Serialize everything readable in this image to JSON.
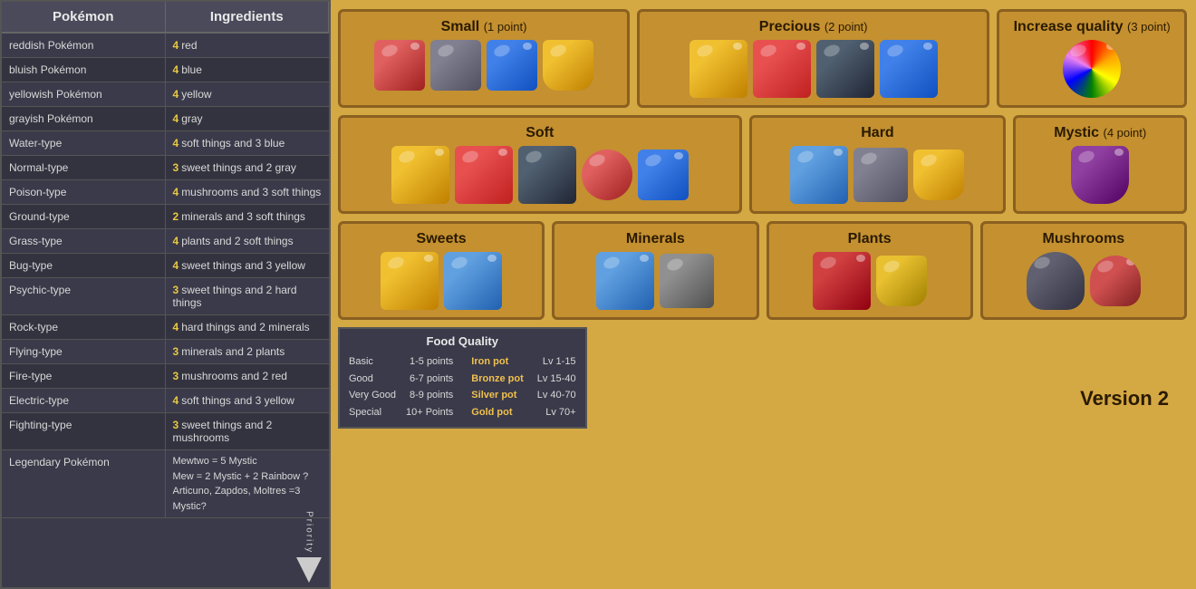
{
  "table": {
    "col1": "Pokémon",
    "col2": "Ingredients",
    "rows": [
      {
        "pokemon": "reddish Pokémon",
        "qty": "4",
        "ingredient": "red"
      },
      {
        "pokemon": "bluish Pokémon",
        "qty": "4",
        "ingredient": "blue"
      },
      {
        "pokemon": "yellowish Pokémon",
        "qty": "4",
        "ingredient": "yellow"
      },
      {
        "pokemon": "grayish Pokémon",
        "qty": "4",
        "ingredient": "gray"
      },
      {
        "pokemon": "Water-type",
        "qty": "4",
        "ingredient": "soft things and 3 blue"
      },
      {
        "pokemon": "Normal-type",
        "qty": "3",
        "ingredient": "sweet things and 2 gray"
      },
      {
        "pokemon": "Poison-type",
        "qty": "4",
        "ingredient": "mushrooms and 3 soft things"
      },
      {
        "pokemon": "Ground-type",
        "qty": "2",
        "ingredient": "minerals and 3 soft things"
      },
      {
        "pokemon": "Grass-type",
        "qty": "4",
        "ingredient": "plants and 2  soft things"
      },
      {
        "pokemon": "Bug-type",
        "qty": "4",
        "ingredient": "sweet things and 3 yellow"
      },
      {
        "pokemon": "Psychic-type",
        "qty": "3",
        "ingredient": "sweet things and 2 hard things"
      },
      {
        "pokemon": "Rock-type",
        "qty": "4",
        "ingredient": "hard things and 2 minerals"
      },
      {
        "pokemon": "Flying-type",
        "qty": "3",
        "ingredient": "minerals and 2 plants"
      },
      {
        "pokemon": "Fire-type",
        "qty": "3",
        "ingredient": "mushrooms and 2 red"
      },
      {
        "pokemon": "Electric-type",
        "qty": "4",
        "ingredient": "soft things and 3 yellow"
      },
      {
        "pokemon": "Fighting-type",
        "qty": "3",
        "ingredient": "sweet things and 2 mushrooms"
      }
    ],
    "legendary": {
      "pokemon": "Legendary  Pokémon",
      "lines": [
        "Mewtwo = 5 Mystic",
        "Mew = 2 Mystic + 2 Rainbow ?",
        "Articuno, Zapdos, Moltres =3 Mystic?"
      ]
    }
  },
  "sections": {
    "row1": [
      {
        "title": "Small",
        "pts": "(1 point)",
        "sprites": [
          "small-red-mushroom",
          "small-gray",
          "small-blue",
          "small-yellow-pot"
        ]
      },
      {
        "title": "Precious",
        "pts": "(2 point)",
        "sprites": [
          "prec-yellow",
          "prec-red",
          "prec-dark",
          "prec-blue"
        ]
      },
      {
        "title": "Increase quality",
        "pts": "(3 point)",
        "sprites": [
          "quality-rainbow"
        ]
      }
    ],
    "row2": [
      {
        "title": "Soft",
        "sprites": [
          "soft-yellow",
          "soft-red",
          "soft-dark",
          "soft-sm-red",
          "soft-blue"
        ]
      },
      {
        "title": "Hard",
        "sprites": [
          "hard-blue",
          "hard-gray",
          "hard-yellow"
        ]
      },
      {
        "title": "Mystic",
        "pts": "(4 point)",
        "sprites": [
          "mystic-purple"
        ]
      }
    ],
    "row3": [
      {
        "title": "Sweets",
        "sprites": [
          "sweet-yellow",
          "sweet-blue"
        ]
      },
      {
        "title": "Minerals",
        "sprites": [
          "mineral-blue",
          "mineral-gray"
        ]
      },
      {
        "title": "Plants",
        "sprites": [
          "plant-red",
          "plant-yellow"
        ]
      },
      {
        "title": "Mushrooms",
        "sprites": [
          "mush-dark",
          "mush-red"
        ]
      }
    ]
  },
  "food_quality": {
    "title": "Food Quality",
    "levels": [
      {
        "label": "Basic",
        "points": "1-5 points"
      },
      {
        "label": "Good",
        "points": "6-7 points"
      },
      {
        "label": "Very Good",
        "points": "8-9 points"
      },
      {
        "label": "Special",
        "points": "10+ Points"
      }
    ],
    "pots": [
      {
        "name": "Iron pot",
        "level": "Lv 1-15"
      },
      {
        "name": "Bronze pot",
        "level": "Lv 15-40"
      },
      {
        "name": "Silver pot",
        "level": "Lv 40-70"
      },
      {
        "name": "Gold pot",
        "level": "Lv 70+"
      }
    ]
  },
  "version": "Version 2",
  "priority_label": "Priority"
}
